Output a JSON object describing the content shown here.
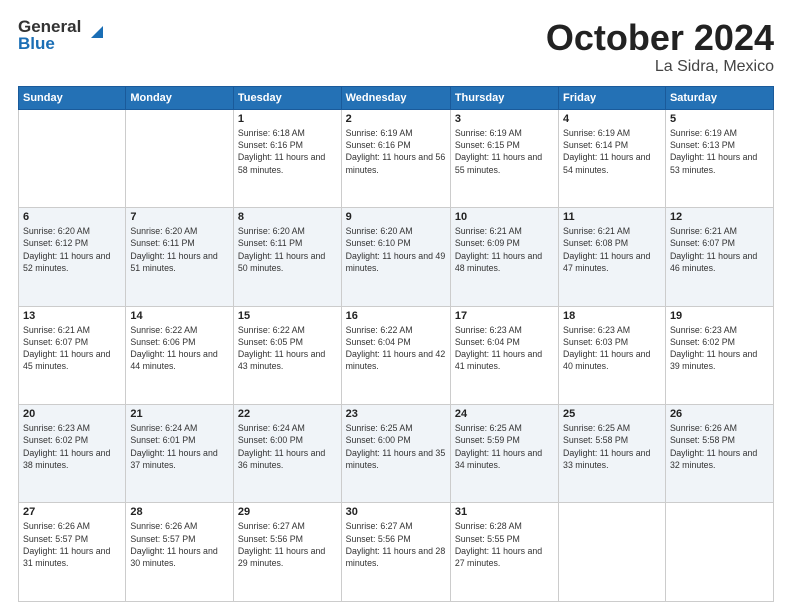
{
  "logo": {
    "general": "General",
    "blue": "Blue"
  },
  "header": {
    "month": "October 2024",
    "location": "La Sidra, Mexico"
  },
  "days_of_week": [
    "Sunday",
    "Monday",
    "Tuesday",
    "Wednesday",
    "Thursday",
    "Friday",
    "Saturday"
  ],
  "weeks": [
    [
      {
        "day": "",
        "empty": true
      },
      {
        "day": "",
        "empty": true
      },
      {
        "day": "1",
        "sunrise": "Sunrise: 6:18 AM",
        "sunset": "Sunset: 6:16 PM",
        "daylight": "Daylight: 11 hours and 58 minutes."
      },
      {
        "day": "2",
        "sunrise": "Sunrise: 6:19 AM",
        "sunset": "Sunset: 6:16 PM",
        "daylight": "Daylight: 11 hours and 56 minutes."
      },
      {
        "day": "3",
        "sunrise": "Sunrise: 6:19 AM",
        "sunset": "Sunset: 6:15 PM",
        "daylight": "Daylight: 11 hours and 55 minutes."
      },
      {
        "day": "4",
        "sunrise": "Sunrise: 6:19 AM",
        "sunset": "Sunset: 6:14 PM",
        "daylight": "Daylight: 11 hours and 54 minutes."
      },
      {
        "day": "5",
        "sunrise": "Sunrise: 6:19 AM",
        "sunset": "Sunset: 6:13 PM",
        "daylight": "Daylight: 11 hours and 53 minutes."
      }
    ],
    [
      {
        "day": "6",
        "sunrise": "Sunrise: 6:20 AM",
        "sunset": "Sunset: 6:12 PM",
        "daylight": "Daylight: 11 hours and 52 minutes."
      },
      {
        "day": "7",
        "sunrise": "Sunrise: 6:20 AM",
        "sunset": "Sunset: 6:11 PM",
        "daylight": "Daylight: 11 hours and 51 minutes."
      },
      {
        "day": "8",
        "sunrise": "Sunrise: 6:20 AM",
        "sunset": "Sunset: 6:11 PM",
        "daylight": "Daylight: 11 hours and 50 minutes."
      },
      {
        "day": "9",
        "sunrise": "Sunrise: 6:20 AM",
        "sunset": "Sunset: 6:10 PM",
        "daylight": "Daylight: 11 hours and 49 minutes."
      },
      {
        "day": "10",
        "sunrise": "Sunrise: 6:21 AM",
        "sunset": "Sunset: 6:09 PM",
        "daylight": "Daylight: 11 hours and 48 minutes."
      },
      {
        "day": "11",
        "sunrise": "Sunrise: 6:21 AM",
        "sunset": "Sunset: 6:08 PM",
        "daylight": "Daylight: 11 hours and 47 minutes."
      },
      {
        "day": "12",
        "sunrise": "Sunrise: 6:21 AM",
        "sunset": "Sunset: 6:07 PM",
        "daylight": "Daylight: 11 hours and 46 minutes."
      }
    ],
    [
      {
        "day": "13",
        "sunrise": "Sunrise: 6:21 AM",
        "sunset": "Sunset: 6:07 PM",
        "daylight": "Daylight: 11 hours and 45 minutes."
      },
      {
        "day": "14",
        "sunrise": "Sunrise: 6:22 AM",
        "sunset": "Sunset: 6:06 PM",
        "daylight": "Daylight: 11 hours and 44 minutes."
      },
      {
        "day": "15",
        "sunrise": "Sunrise: 6:22 AM",
        "sunset": "Sunset: 6:05 PM",
        "daylight": "Daylight: 11 hours and 43 minutes."
      },
      {
        "day": "16",
        "sunrise": "Sunrise: 6:22 AM",
        "sunset": "Sunset: 6:04 PM",
        "daylight": "Daylight: 11 hours and 42 minutes."
      },
      {
        "day": "17",
        "sunrise": "Sunrise: 6:23 AM",
        "sunset": "Sunset: 6:04 PM",
        "daylight": "Daylight: 11 hours and 41 minutes."
      },
      {
        "day": "18",
        "sunrise": "Sunrise: 6:23 AM",
        "sunset": "Sunset: 6:03 PM",
        "daylight": "Daylight: 11 hours and 40 minutes."
      },
      {
        "day": "19",
        "sunrise": "Sunrise: 6:23 AM",
        "sunset": "Sunset: 6:02 PM",
        "daylight": "Daylight: 11 hours and 39 minutes."
      }
    ],
    [
      {
        "day": "20",
        "sunrise": "Sunrise: 6:23 AM",
        "sunset": "Sunset: 6:02 PM",
        "daylight": "Daylight: 11 hours and 38 minutes."
      },
      {
        "day": "21",
        "sunrise": "Sunrise: 6:24 AM",
        "sunset": "Sunset: 6:01 PM",
        "daylight": "Daylight: 11 hours and 37 minutes."
      },
      {
        "day": "22",
        "sunrise": "Sunrise: 6:24 AM",
        "sunset": "Sunset: 6:00 PM",
        "daylight": "Daylight: 11 hours and 36 minutes."
      },
      {
        "day": "23",
        "sunrise": "Sunrise: 6:25 AM",
        "sunset": "Sunset: 6:00 PM",
        "daylight": "Daylight: 11 hours and 35 minutes."
      },
      {
        "day": "24",
        "sunrise": "Sunrise: 6:25 AM",
        "sunset": "Sunset: 5:59 PM",
        "daylight": "Daylight: 11 hours and 34 minutes."
      },
      {
        "day": "25",
        "sunrise": "Sunrise: 6:25 AM",
        "sunset": "Sunset: 5:58 PM",
        "daylight": "Daylight: 11 hours and 33 minutes."
      },
      {
        "day": "26",
        "sunrise": "Sunrise: 6:26 AM",
        "sunset": "Sunset: 5:58 PM",
        "daylight": "Daylight: 11 hours and 32 minutes."
      }
    ],
    [
      {
        "day": "27",
        "sunrise": "Sunrise: 6:26 AM",
        "sunset": "Sunset: 5:57 PM",
        "daylight": "Daylight: 11 hours and 31 minutes."
      },
      {
        "day": "28",
        "sunrise": "Sunrise: 6:26 AM",
        "sunset": "Sunset: 5:57 PM",
        "daylight": "Daylight: 11 hours and 30 minutes."
      },
      {
        "day": "29",
        "sunrise": "Sunrise: 6:27 AM",
        "sunset": "Sunset: 5:56 PM",
        "daylight": "Daylight: 11 hours and 29 minutes."
      },
      {
        "day": "30",
        "sunrise": "Sunrise: 6:27 AM",
        "sunset": "Sunset: 5:56 PM",
        "daylight": "Daylight: 11 hours and 28 minutes."
      },
      {
        "day": "31",
        "sunrise": "Sunrise: 6:28 AM",
        "sunset": "Sunset: 5:55 PM",
        "daylight": "Daylight: 11 hours and 27 minutes."
      },
      {
        "day": "",
        "empty": true
      },
      {
        "day": "",
        "empty": true
      }
    ]
  ]
}
